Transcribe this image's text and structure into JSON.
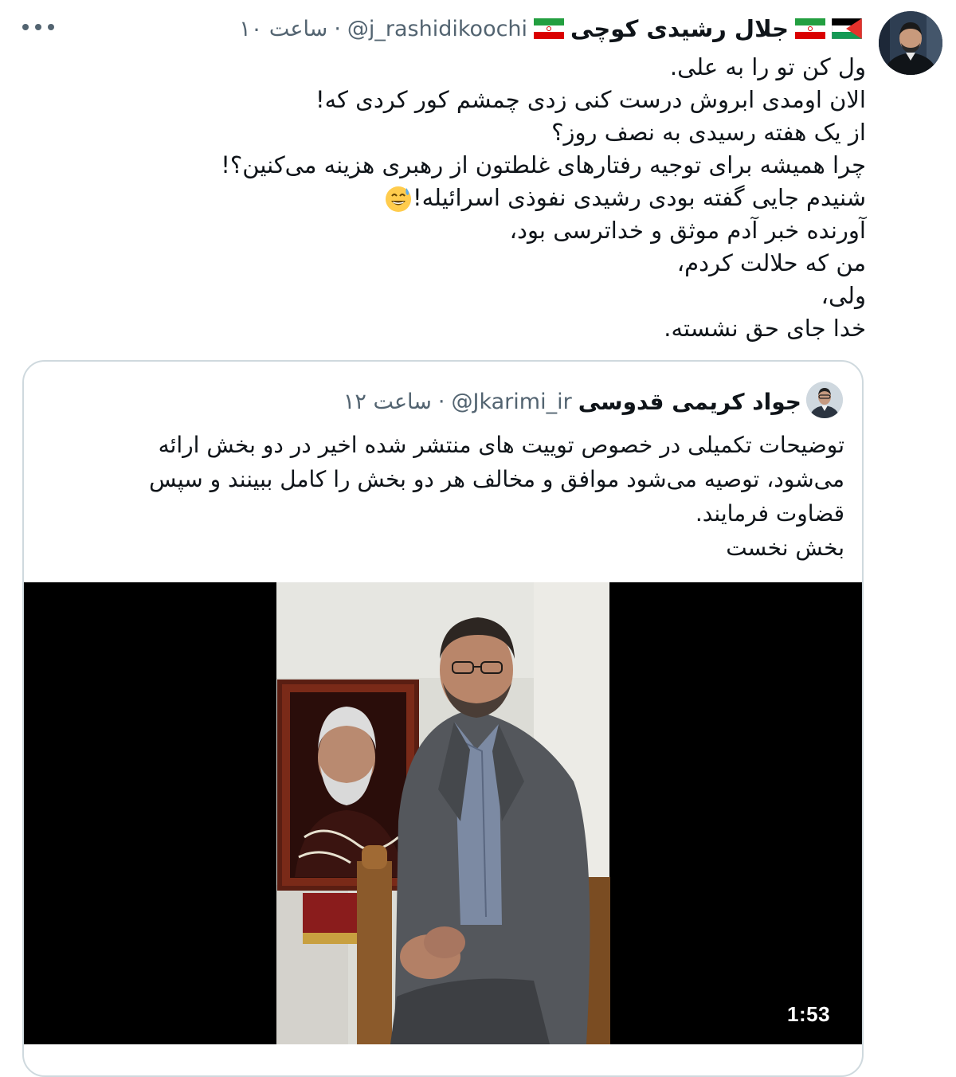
{
  "main_tweet": {
    "author_name": "جلال رشیدی کوچی",
    "handle": "@j_rashidikoochi",
    "time": "۱۰ ساعت",
    "separator": "·",
    "lines": [
      "ول کن تو را به علی.",
      "الان اومدی ابروش درست کنی زدی چمشم کور کردی که!",
      "از یک هفته رسیدی به نصف روز؟",
      "چرا همیشه برای توجیه رفتارهای غلطتون از رهبری هزینه می‌کنین؟!",
      "شنیدم جایی گفته بودی رشیدی نفوذی اسرائیله!",
      "آورنده خبر آدم موثق و خداترسی بود،",
      "من که حلالت کردم،",
      "ولی،",
      "خدا جای حق نشسته."
    ],
    "emoji": "grinning-face-with-sweat-icon"
  },
  "quoted_tweet": {
    "author_name": "جواد کریمی قدوسی",
    "handle": "@Jkarimi_ir",
    "time": "۱۲ ساعت",
    "separator": "·",
    "lines": [
      "توضیحات تکمیلی در خصوص توییت های منتشر شده اخیر در دو بخش ارائه",
      "می‌شود، توصیه می‌شود موافق و مخالف هر دو بخش را کامل ببینند و سپس",
      "قضاوت فرمایند.",
      "بخش نخست"
    ],
    "video": {
      "duration": "1:53"
    }
  },
  "colors": {
    "text": "#0f1419",
    "secondary": "#536471",
    "border": "#cfd9de"
  }
}
